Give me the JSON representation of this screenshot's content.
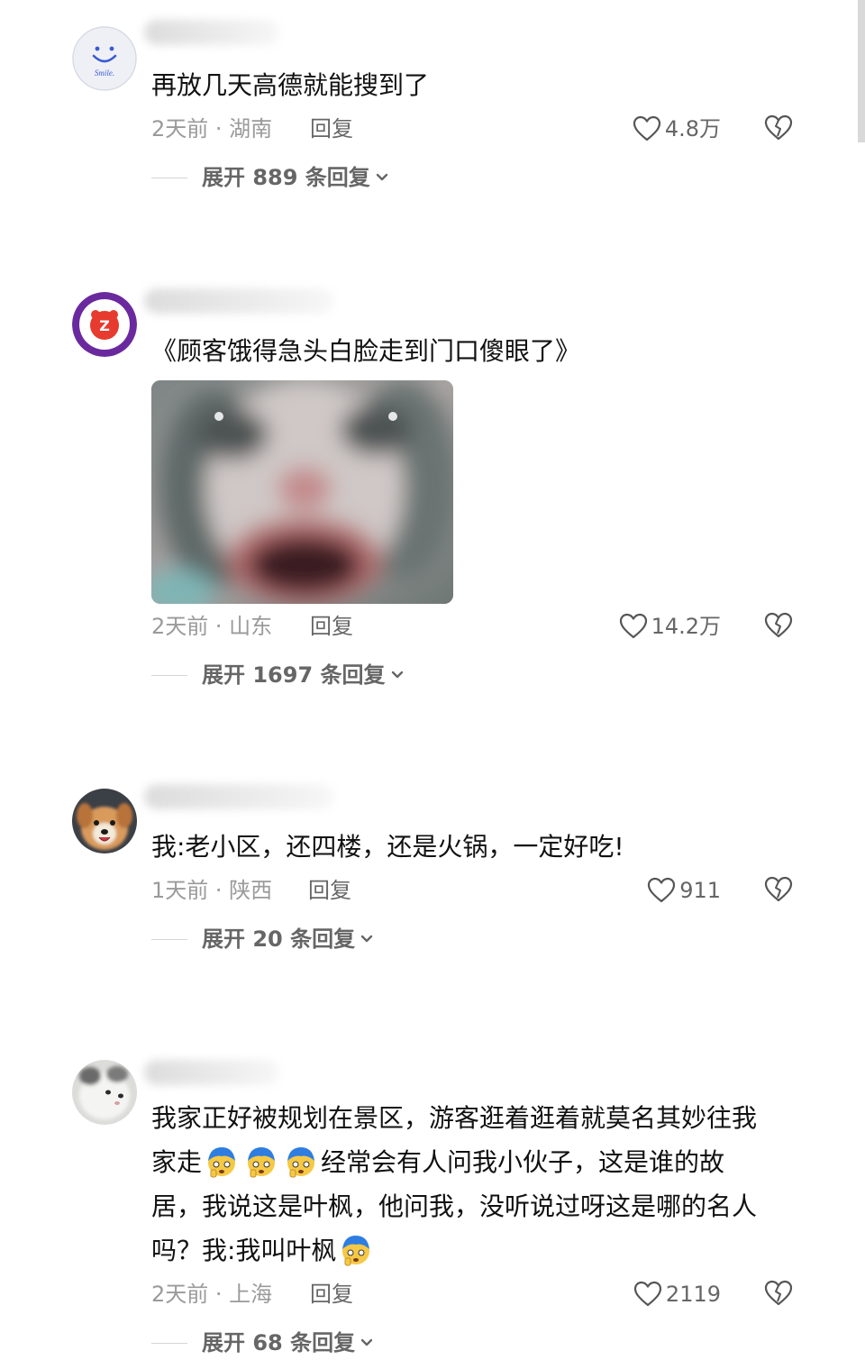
{
  "comments": [
    {
      "text": "再放几天高德就能搜到了",
      "time_location": "2天前 · 湖南",
      "reply_label": "回复",
      "likes": "4.8万",
      "expand_label": "展开 889 条回复",
      "avatar_label": "Smile."
    },
    {
      "text": "《顾客饿得急头白脸走到门口傻眼了》",
      "time_location": "2天前 · 山东",
      "reply_label": "回复",
      "likes": "14.2万",
      "expand_label": "展开 1697 条回复",
      "avatar_label": "Z"
    },
    {
      "text": "我:老小区，还四楼，还是火锅，一定好吃!",
      "time_location": "1天前 · 陕西",
      "reply_label": "回复",
      "likes": "911",
      "expand_label": "展开 20 条回复"
    },
    {
      "text_lines": [
        "我家正好被规划在景区，游客逛着逛着就莫名其妙往我",
        "家走",
        "经常会有人问我小伙子，这是谁的故",
        "居，我说这是叶枫，他问我，没听说过呀这是哪的名人",
        "吗？我:我叫叶枫"
      ],
      "time_location": "2天前 · 上海",
      "reply_label": "回复",
      "likes": "2119",
      "expand_label": "展开 68 条回复"
    }
  ],
  "colors": {
    "text": "#111111",
    "meta": "#9a9a9a",
    "secondary": "#666666",
    "background": "#ffffff"
  },
  "icons": {
    "like": "heart-outline-icon",
    "dislike": "broken-heart-icon",
    "expand": "chevron-down-icon",
    "emoji": "shocked-face-emoji-icon"
  }
}
